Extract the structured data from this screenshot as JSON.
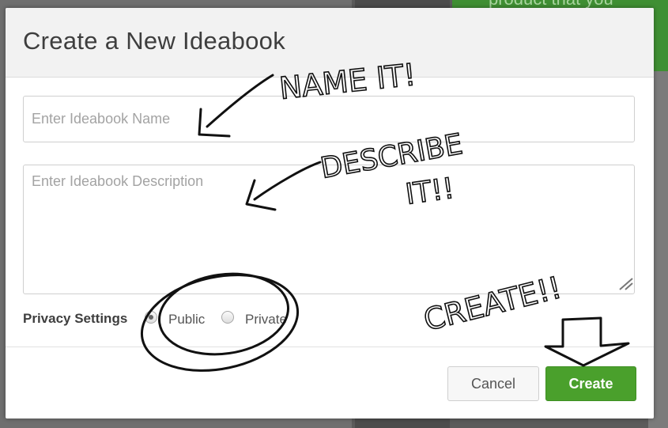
{
  "background": {
    "promo_text": "product that you"
  },
  "dialog": {
    "title": "Create a New Ideabook",
    "name_placeholder": "Enter Ideabook Name",
    "description_placeholder": "Enter Ideabook Description",
    "privacy_label": "Privacy Settings",
    "privacy_options": [
      "Public",
      "Private"
    ],
    "privacy_selected": "Public",
    "cancel_label": "Cancel",
    "create_label": "Create"
  },
  "annotations": {
    "name_note": "NAME IT!",
    "describe_note_line1": "DESCRIBE",
    "describe_note_line2": "IT!!",
    "create_note": "CREATE!!"
  },
  "colors": {
    "primary_button": "#4aa02c",
    "header_bg": "#f2f2f2",
    "promo_bg": "#3f8f33"
  }
}
